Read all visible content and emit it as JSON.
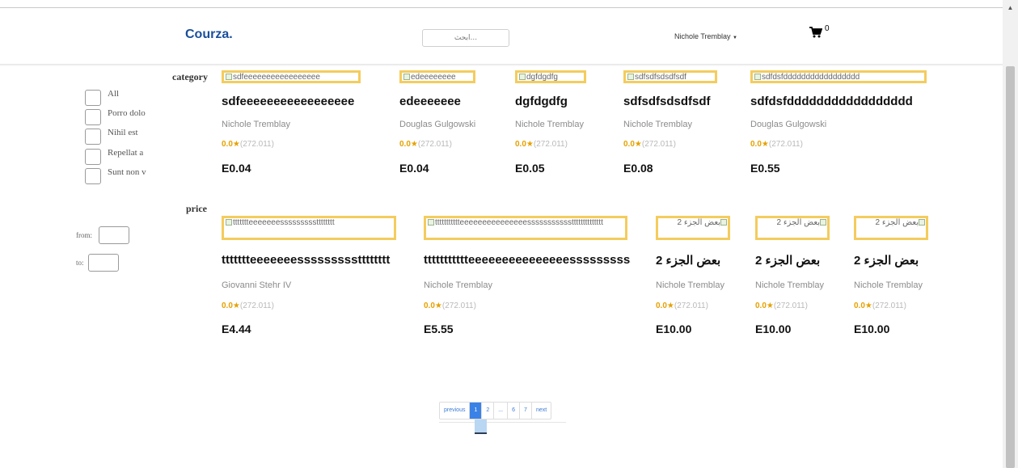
{
  "header": {
    "brand": "Courza.",
    "search_placeholder": "ابحث...",
    "user_name": "Nichole Tremblay",
    "cart_count": "0"
  },
  "sidebar": {
    "category_label": "category",
    "categories": [
      "All",
      "Porro dolo",
      "Nihil est",
      "Repellat a",
      "Sunt non v"
    ],
    "price_label": "price",
    "from_label": "from:",
    "to_label": "to:"
  },
  "products": [
    {
      "img_alt": "sdfeeeeeeeeeeeeeeeee",
      "title": "sdfeeeeeeeeeeeeeeeee",
      "author": "Nichole Tremblay",
      "rating": "0.0",
      "count": "(272.011)",
      "price": "E0.04"
    },
    {
      "img_alt": "edeeeeeeee",
      "title": "edeeeeeee",
      "author": "Douglas Gulgowski",
      "rating": "0.0",
      "count": "(272.011)",
      "price": "E0.04"
    },
    {
      "img_alt": "dgfdgdfg",
      "title": "dgfdgdfg",
      "author": "Nichole Tremblay",
      "rating": "0.0",
      "count": "(272.011)",
      "price": "E0.05"
    },
    {
      "img_alt": "sdfsdfsdsdfsdf",
      "title": "sdfsdfsdsdfsdf",
      "author": "Nichole Tremblay",
      "rating": "0.0",
      "count": "(272.011)",
      "price": "E0.08"
    },
    {
      "img_alt": "sdfdsfddddddddddddddddd",
      "title": "sdfdsfddddddddddddddddd",
      "author": "Douglas Gulgowski",
      "rating": "0.0",
      "count": "(272.011)",
      "price": "E0.55"
    },
    {
      "img_alt": "ttttttteeeeeeessssssssstttttttt",
      "title": "ttttttteeeeeeessssssssstttttttt",
      "author": "Giovanni Stehr IV",
      "rating": "0.0",
      "count": "(272.011)",
      "price": "E4.44"
    },
    {
      "img_alt": "ttttttttttteeeeeeeeeeeeeeessssssssssstttttttttttttt",
      "title": "ttttttttttteeeeeeeeeeeeeeessssssssssss",
      "author": "Nichole Tremblay",
      "rating": "0.0",
      "count": "(272.011)",
      "price": "E5.55"
    },
    {
      "img_alt": "بعض الجزء 2",
      "title": "بعض الجزء 2",
      "author": "Nichole Tremblay",
      "rating": "0.0",
      "count": "(272.011)",
      "price": "E10.00"
    },
    {
      "img_alt": "بعض الجزء 2",
      "title": "بعض الجزء 2",
      "author": "Nichole Tremblay",
      "rating": "0.0",
      "count": "(272.011)",
      "price": "E10.00"
    },
    {
      "img_alt": "بعض الجزء 2",
      "title": "بعض الجزء 2",
      "author": "Nichole Tremblay",
      "rating": "0.0",
      "count": "(272.011)",
      "price": "E10.00"
    }
  ],
  "pagination": {
    "previous": "previous",
    "pages": [
      "1",
      "2",
      "...",
      "6",
      "7"
    ],
    "next": "next"
  }
}
